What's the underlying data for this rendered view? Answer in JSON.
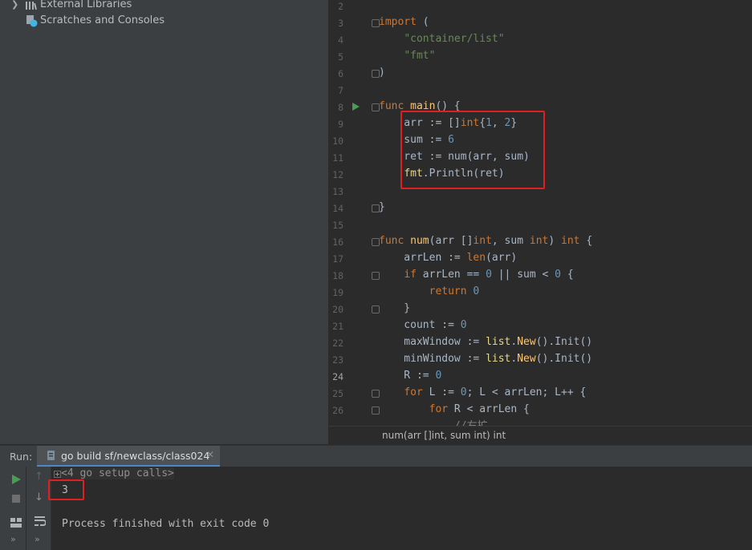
{
  "project_tree": {
    "items": [
      {
        "label": "External Libraries"
      },
      {
        "label": "Scratches and Consoles"
      }
    ]
  },
  "editor": {
    "line_numbers": [
      "2",
      "3",
      "4",
      "5",
      "6",
      "7",
      "8",
      "9",
      "10",
      "11",
      "12",
      "13",
      "14",
      "15",
      "16",
      "17",
      "18",
      "19",
      "20",
      "21",
      "22",
      "23",
      "24",
      "25",
      "26"
    ],
    "current_line": "24",
    "tooltip": "num(arr []int, sum int) int"
  },
  "run": {
    "label": "Run:",
    "tab_title": "go build sf/newclass/class024",
    "console": {
      "setup_calls": "<4 go setup calls>",
      "output": "3",
      "exit_message": "Process finished with exit code 0"
    }
  },
  "colors": {
    "highlight_box": "#e02020",
    "keyword": "#cc7832",
    "string": "#6a8759",
    "number": "#6897bb",
    "function": "#ffc66d"
  },
  "icons": [
    "library-icon",
    "scratches-icon",
    "run-icon",
    "stop-icon",
    "arrow-up-icon",
    "arrow-down-icon",
    "wrap-icon",
    "layout-icon",
    "go-file-icon",
    "close-icon",
    "expand-icon"
  ]
}
